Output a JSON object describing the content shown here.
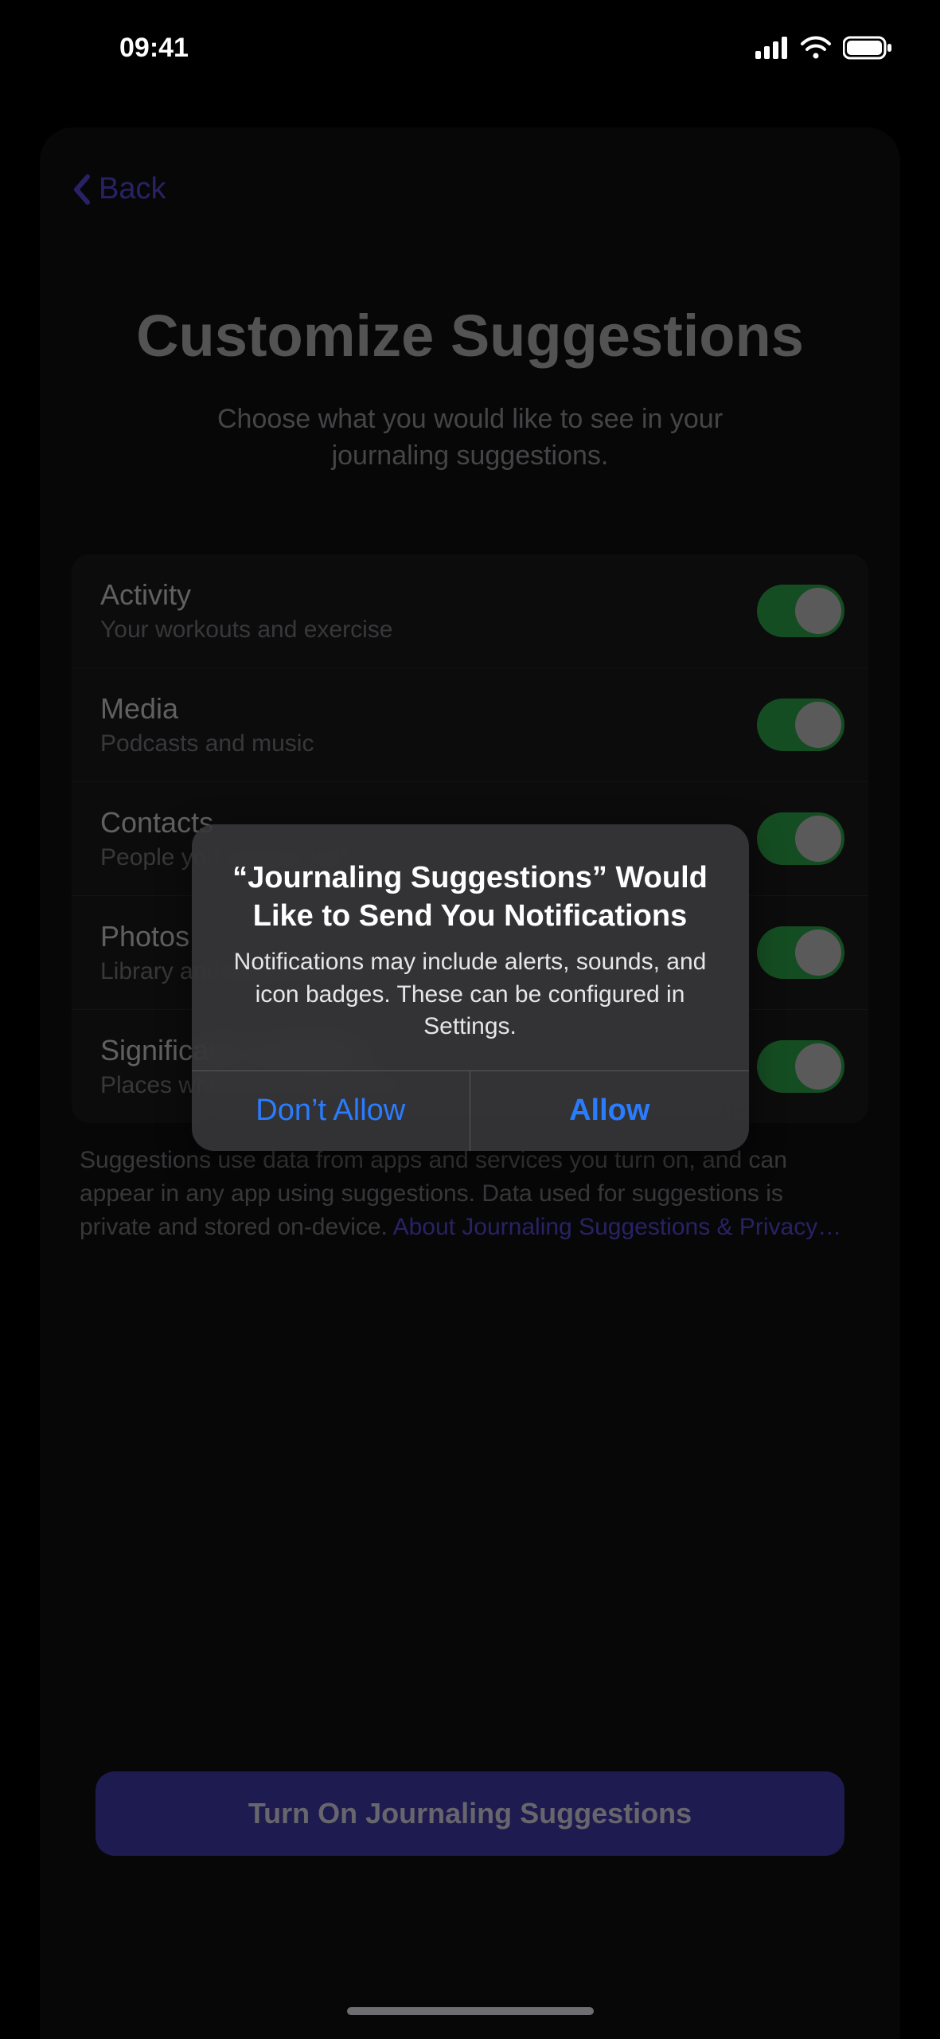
{
  "status": {
    "time": "09:41"
  },
  "nav": {
    "back": "Back"
  },
  "page": {
    "title": "Customize Suggestions",
    "subtitle": "Choose what you would like to see in your journaling suggestions."
  },
  "settings": [
    {
      "title": "Activity",
      "subtitle": "Your workouts and exercise",
      "on": true
    },
    {
      "title": "Media",
      "subtitle": "Podcasts and music",
      "on": true
    },
    {
      "title": "Contacts",
      "subtitle": "People you interact with",
      "on": true
    },
    {
      "title": "Photos",
      "subtitle": "Library and shared photos",
      "on": true
    },
    {
      "title": "Significant Locations",
      "subtitle": "Places where you spend time",
      "on": true
    }
  ],
  "disclaimer": {
    "text": "Suggestions use data from apps and services you turn on, and can appear in any app using suggestions. Data used for suggestions is private and stored on-device. ",
    "link": "About Journaling Suggestions & Privacy…"
  },
  "primary_button": "Turn On Journaling Suggestions",
  "alert": {
    "title": "“Journaling Suggestions” Would Like to Send You Notifications",
    "message": "Notifications may include alerts, sounds, and icon badges. These can be configured in Settings.",
    "deny": "Don’t Allow",
    "allow": "Allow"
  }
}
